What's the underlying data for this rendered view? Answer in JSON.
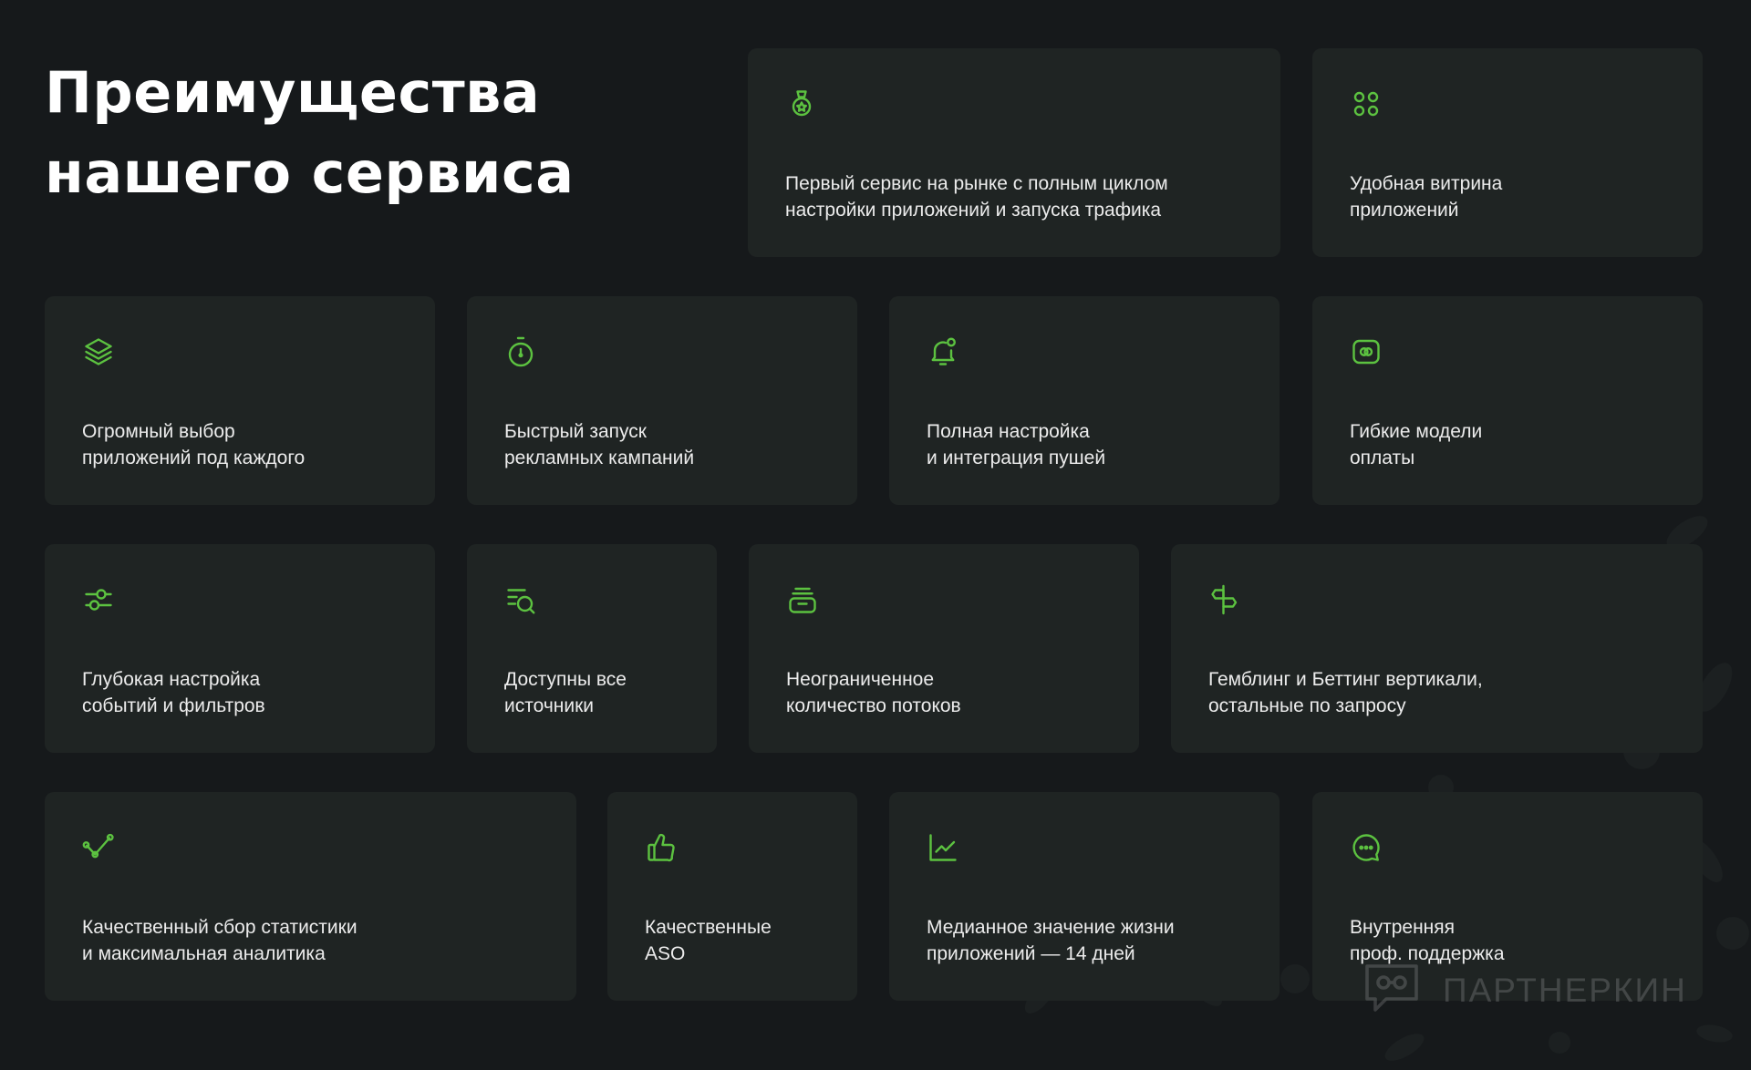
{
  "title": "Преимущества\nнашего сервиса",
  "accent_color": "#5cc240",
  "card_bg": "#1f2423",
  "page_bg": "#16191b",
  "cards": [
    {
      "icon": "medal-icon",
      "text": "Первый сервис на рынке с полным циклом\nнастройки приложений и запуска трафика"
    },
    {
      "icon": "grid-icon",
      "text": "Удобная витрина\nприложений"
    },
    {
      "icon": "layers-icon",
      "text": "Огромный выбор\nприложений под каждого"
    },
    {
      "icon": "stopwatch-icon",
      "text": "Быстрый запуск\nрекламных кампаний"
    },
    {
      "icon": "bell-icon",
      "text": "Полная настройка\nи интеграция пушей"
    },
    {
      "icon": "wallet-icon",
      "text": "Гибкие модели\nоплаты"
    },
    {
      "icon": "sliders-icon",
      "text": "Глубокая настройка\nсобытий и фильтров"
    },
    {
      "icon": "list-search-icon",
      "text": "Доступны все\nисточники"
    },
    {
      "icon": "inbox-stack-icon",
      "text": "Неограниченное\nколичество потоков"
    },
    {
      "icon": "signpost-icon",
      "text": "Гемблинг и Беттинг вертикали,\nостальные по запросу"
    },
    {
      "icon": "trend-line-icon",
      "text": "Качественный сбор статистики\nи максимальная аналитика"
    },
    {
      "icon": "thumbs-up-icon",
      "text": "Качественные\nASO"
    },
    {
      "icon": "chart-icon",
      "text": "Медианное значение жизни\nприложений — 14 дней"
    },
    {
      "icon": "chat-bubble-icon",
      "text": "Внутренняя\nпроф. поддержка"
    }
  ],
  "watermark": {
    "text": "ПАРТНЕРКИН",
    "icon": "watermark-logo-icon"
  }
}
